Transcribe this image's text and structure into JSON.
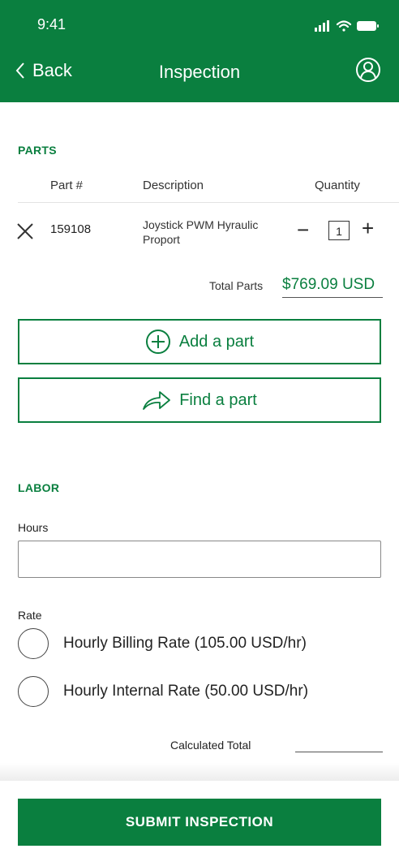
{
  "status_bar": {
    "time": "9:41",
    "icons": [
      "signal-icon",
      "wifi-icon",
      "battery-icon"
    ]
  },
  "nav": {
    "back_label": "Back",
    "title": "Inspection",
    "profile_icon": "user-circle-icon"
  },
  "colors": {
    "brand": "#0a7f3f",
    "text": "#222222",
    "background": "#ffffff"
  },
  "parts": {
    "section_title": "PARTS",
    "columns": [
      "Part #",
      "Description",
      "Quantity"
    ],
    "rows": [
      {
        "part_number": "159108",
        "description": "Joystick PWM Hyraulic Proport",
        "quantity": "1"
      }
    ],
    "total_label": "Total Parts",
    "total_value": "$769.09 USD",
    "add_button": "Add a part",
    "find_button": "Find a part"
  },
  "labor": {
    "section_title": "LABOR",
    "hours_label": "Hours",
    "hours_value": "",
    "rate_label": "Rate",
    "rates": [
      {
        "label": "Hourly Billing Rate (105.00 USD/hr)",
        "selected": false
      },
      {
        "label": "Hourly Internal Rate (50.00 USD/hr)",
        "selected": false
      }
    ],
    "calculated_total_label": "Calculated Total",
    "calculated_total_value": ""
  },
  "footer": {
    "submit_label": "SUBMIT INSPECTION"
  }
}
